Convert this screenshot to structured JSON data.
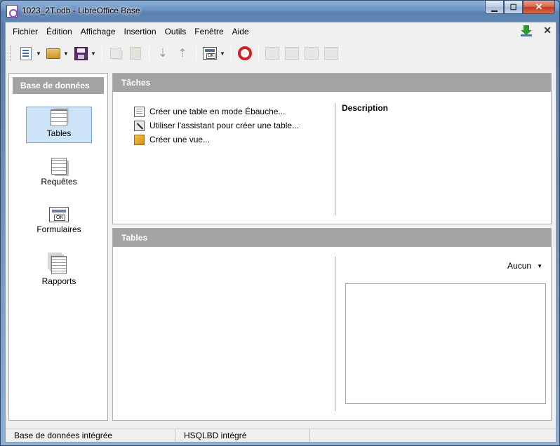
{
  "window": {
    "title": "1023_2T.odb - LibreOffice Base",
    "controls": [
      "minimize",
      "maximize",
      "close"
    ]
  },
  "menu": [
    {
      "label": "Fichier",
      "accel": "F"
    },
    {
      "label": "Édition",
      "accel": "É"
    },
    {
      "label": "Affichage",
      "accel": "A"
    },
    {
      "label": "Insertion",
      "accel": "I"
    },
    {
      "label": "Outils",
      "accel": "O"
    },
    {
      "label": "Fenêtre",
      "accel": "n"
    },
    {
      "label": "Aide",
      "accel": "d"
    }
  ],
  "toolbar": {
    "icons": [
      "new-document-icon",
      "open-icon",
      "save-icon",
      "copy-icon",
      "paste-icon",
      "sort-descending-icon",
      "sort-ascending-icon",
      "form-icon",
      "help-lifebuoy-icon",
      "open-object-icon",
      "edit-icon",
      "delete-icon",
      "rename-icon"
    ]
  },
  "left_panel": {
    "header": "Base de données",
    "items": [
      {
        "label": "Tables",
        "selected": true,
        "icon": "tables-icon"
      },
      {
        "label": "Requêtes",
        "selected": false,
        "icon": "queries-icon"
      },
      {
        "label": "Formulaires",
        "selected": false,
        "icon": "forms-icon"
      },
      {
        "label": "Rapports",
        "selected": false,
        "icon": "reports-icon"
      }
    ]
  },
  "tasks_panel": {
    "header": "Tâches",
    "tasks": [
      {
        "label": "Créer une table en mode Ébauche...",
        "icon": "table-design-icon"
      },
      {
        "label": "Utiliser l'assistant pour créer une table...",
        "icon": "wizard-icon"
      },
      {
        "label": "Créer une vue...",
        "icon": "view-icon"
      }
    ],
    "description_label": "Description"
  },
  "tables_panel": {
    "header": "Tables",
    "preview_mode": "Aucun"
  },
  "statusbar": {
    "left": "Base de données intégrée",
    "middle": "HSQLBD intégré"
  }
}
